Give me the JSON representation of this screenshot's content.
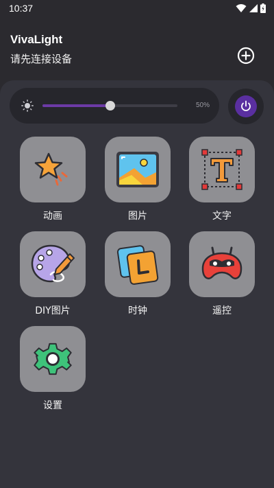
{
  "status": {
    "time": "10:37"
  },
  "header": {
    "title": "VivaLight",
    "subtitle": "请先连接设备"
  },
  "brightness": {
    "value": 0.5,
    "label": "50%"
  },
  "tiles": [
    {
      "label": "动画",
      "icon": "star-icon"
    },
    {
      "label": "图片",
      "icon": "picture-icon"
    },
    {
      "label": "文字",
      "icon": "text-icon"
    },
    {
      "label": "DIY图片",
      "icon": "palette-icon"
    },
    {
      "label": "时钟",
      "icon": "clock-cards-icon"
    },
    {
      "label": "遥控",
      "icon": "gamepad-icon"
    },
    {
      "label": "设置",
      "icon": "gear-icon"
    }
  ],
  "colors": {
    "background": "#2b2a2f",
    "panel": "#34343c",
    "tile": "#8f8f93",
    "accent": "#6c3aa6",
    "power": "#5a2fa0"
  }
}
